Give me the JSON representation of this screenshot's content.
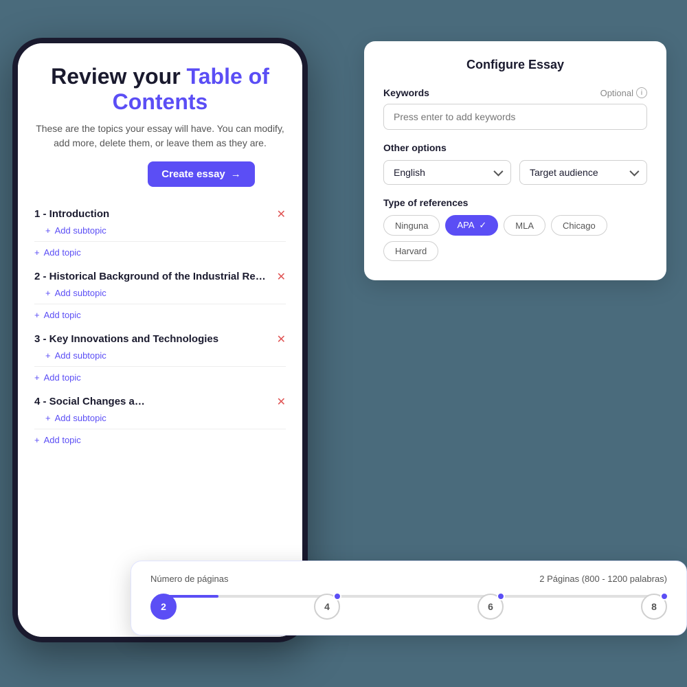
{
  "phone": {
    "title_part1": "Review your ",
    "title_highlight": "Table of Contents",
    "subtitle": "These are the topics your essay will have. You can modify, add more, delete them, or leave them as they are.",
    "create_essay_btn": "Create essay",
    "topics": [
      {
        "id": 1,
        "title": "1 - Introduction",
        "add_subtopic": "Add subtopic",
        "add_topic": "Add topic"
      },
      {
        "id": 2,
        "title": "2 - Historical Background of the Industrial Re…",
        "add_subtopic": "Add subtopic",
        "add_topic": "Add topic"
      },
      {
        "id": 3,
        "title": "3 - Key Innovations and Technologies",
        "add_subtopic": "Add subtopic",
        "add_topic": "Add topic"
      },
      {
        "id": 4,
        "title": "4 - Social Changes a…",
        "add_subtopic": "Add subtopic",
        "add_topic": "Add topic"
      }
    ]
  },
  "configure": {
    "title": "Configure Essay",
    "keywords_label": "Keywords",
    "optional_label": "Optional",
    "keywords_placeholder": "Press enter to add keywords",
    "other_options_label": "Other options",
    "language_dropdown": "English",
    "audience_dropdown": "Target audience",
    "references_label": "Type of references",
    "reference_chips": [
      {
        "id": "ninguna",
        "label": "Ninguna",
        "active": false
      },
      {
        "id": "apa",
        "label": "APA",
        "active": true
      },
      {
        "id": "mla",
        "label": "MLA",
        "active": false
      },
      {
        "id": "chicago",
        "label": "Chicago",
        "active": false
      },
      {
        "id": "harvard",
        "label": "Harvard",
        "active": false
      }
    ]
  },
  "pages": {
    "label": "Número de páginas",
    "info": "2 Páginas (800 - 1200 palabras)",
    "values": [
      {
        "val": "2",
        "active": true
      },
      {
        "val": "4",
        "active": false
      },
      {
        "val": "6",
        "active": false
      },
      {
        "val": "8",
        "active": false
      }
    ]
  }
}
